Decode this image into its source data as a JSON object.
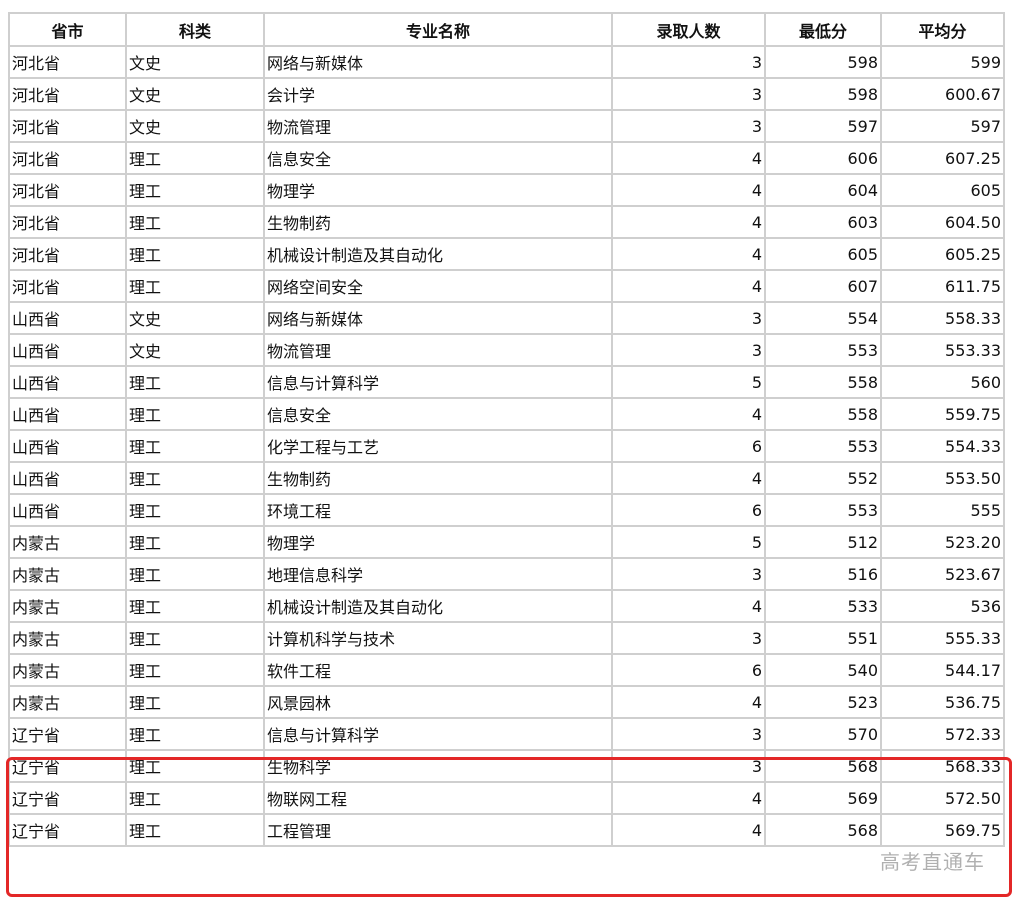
{
  "table": {
    "headers": [
      "省市",
      "科类",
      "专业名称",
      "录取人数",
      "最低分",
      "平均分"
    ],
    "rows": [
      [
        "河北省",
        "文史",
        "网络与新媒体",
        "3",
        "598",
        "599"
      ],
      [
        "河北省",
        "文史",
        "会计学",
        "3",
        "598",
        "600.67"
      ],
      [
        "河北省",
        "文史",
        "物流管理",
        "3",
        "597",
        "597"
      ],
      [
        "河北省",
        "理工",
        "信息安全",
        "4",
        "606",
        "607.25"
      ],
      [
        "河北省",
        "理工",
        "物理学",
        "4",
        "604",
        "605"
      ],
      [
        "河北省",
        "理工",
        "生物制药",
        "4",
        "603",
        "604.50"
      ],
      [
        "河北省",
        "理工",
        "机械设计制造及其自动化",
        "4",
        "605",
        "605.25"
      ],
      [
        "河北省",
        "理工",
        "网络空间安全",
        "4",
        "607",
        "611.75"
      ],
      [
        "山西省",
        "文史",
        "网络与新媒体",
        "3",
        "554",
        "558.33"
      ],
      [
        "山西省",
        "文史",
        "物流管理",
        "3",
        "553",
        "553.33"
      ],
      [
        "山西省",
        "理工",
        "信息与计算科学",
        "5",
        "558",
        "560"
      ],
      [
        "山西省",
        "理工",
        "信息安全",
        "4",
        "558",
        "559.75"
      ],
      [
        "山西省",
        "理工",
        "化学工程与工艺",
        "6",
        "553",
        "554.33"
      ],
      [
        "山西省",
        "理工",
        "生物制药",
        "4",
        "552",
        "553.50"
      ],
      [
        "山西省",
        "理工",
        "环境工程",
        "6",
        "553",
        "555"
      ],
      [
        "内蒙古",
        "理工",
        "物理学",
        "5",
        "512",
        "523.20"
      ],
      [
        "内蒙古",
        "理工",
        "地理信息科学",
        "3",
        "516",
        "523.67"
      ],
      [
        "内蒙古",
        "理工",
        "机械设计制造及其自动化",
        "4",
        "533",
        "536"
      ],
      [
        "内蒙古",
        "理工",
        "计算机科学与技术",
        "3",
        "551",
        "555.33"
      ],
      [
        "内蒙古",
        "理工",
        "软件工程",
        "6",
        "540",
        "544.17"
      ],
      [
        "内蒙古",
        "理工",
        "风景园林",
        "4",
        "523",
        "536.75"
      ],
      [
        "辽宁省",
        "理工",
        "信息与计算科学",
        "3",
        "570",
        "572.33"
      ],
      [
        "辽宁省",
        "理工",
        "生物科学",
        "3",
        "568",
        "568.33"
      ],
      [
        "辽宁省",
        "理工",
        "物联网工程",
        "4",
        "569",
        "572.50"
      ],
      [
        "辽宁省",
        "理工",
        "工程管理",
        "4",
        "568",
        "569.75"
      ]
    ]
  },
  "watermark": "高考直通车",
  "colors": {
    "highlight": "#e32727",
    "border": "#cfcfcf"
  }
}
